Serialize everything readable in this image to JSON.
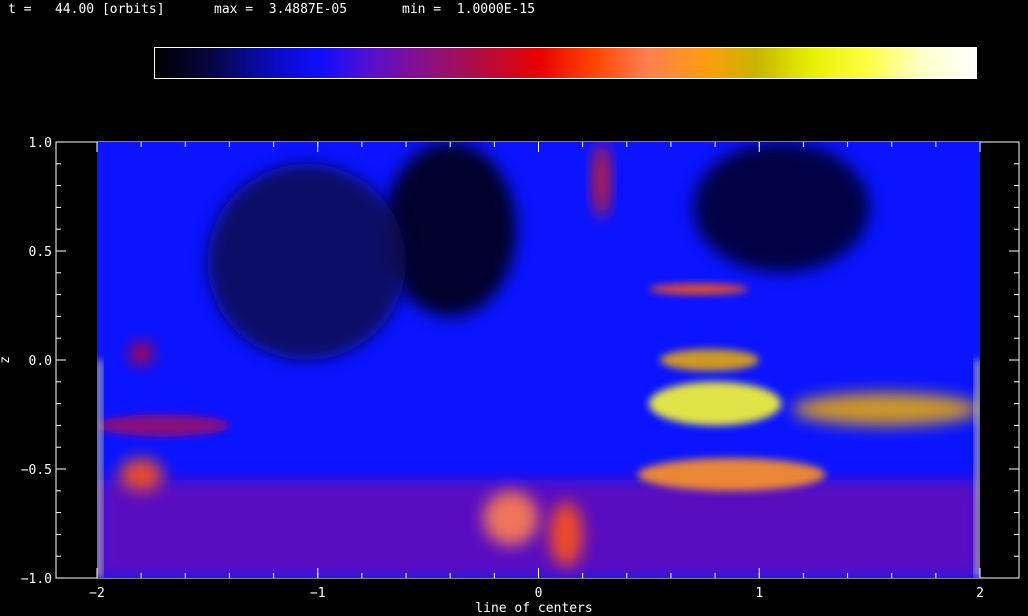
{
  "header": {
    "time_label": "t =",
    "time_value": "44.00",
    "time_unit": "[orbits]",
    "max_label": "max =",
    "max_value": "3.4887E-05",
    "min_label": "min =",
    "min_value": "1.0000E-15"
  },
  "colorbar": {
    "stops": [
      "#000000",
      "#060640",
      "#0a0ab0",
      "#0e0eff",
      "#5a10c8",
      "#8c1080",
      "#b40c3c",
      "#e80000",
      "#ff4400",
      "#ff8050",
      "#ff9a10",
      "#c8b400",
      "#e6f000",
      "#ffff40",
      "#ffffc8",
      "#ffffff"
    ]
  },
  "chart_data": {
    "type": "heatmap",
    "xlabel": "line of centers",
    "ylabel": "z",
    "xlim": [
      -2,
      2
    ],
    "ylim": [
      -1.0,
      1.0
    ],
    "xticks": [
      -2,
      -1,
      0,
      1,
      2
    ],
    "xtick_labels": [
      "−2",
      "−1",
      "0",
      "1",
      "2"
    ],
    "yticks": [
      -1.0,
      -0.5,
      0.0,
      0.5,
      1.0
    ],
    "ytick_labels": [
      "−1.0",
      "−0.5",
      "0.0",
      "0.5",
      "1.0"
    ],
    "value_range": [
      1e-15,
      3.4887e-05
    ],
    "background_color": "#0a14ff",
    "features": [
      {
        "kind": "band",
        "x": [
          -2.0,
          2.0
        ],
        "y": [
          -1.0,
          -0.55
        ],
        "level": 0.28
      },
      {
        "kind": "blob",
        "x": [
          -0.7,
          -0.1
        ],
        "y": [
          0.2,
          1.0
        ],
        "level": 0.02
      },
      {
        "kind": "blob",
        "x": [
          -1.5,
          -0.6
        ],
        "y": [
          0.0,
          0.9
        ],
        "level": 0.08
      },
      {
        "kind": "blob",
        "x": [
          0.7,
          1.5
        ],
        "y": [
          0.4,
          1.0
        ],
        "level": 0.05
      },
      {
        "kind": "streak",
        "x": [
          -2.0,
          -1.4
        ],
        "y": [
          -0.35,
          -0.25
        ],
        "level": 0.35
      },
      {
        "kind": "blob",
        "x": [
          -1.85,
          -1.75
        ],
        "y": [
          -0.02,
          0.08
        ],
        "level": 0.45
      },
      {
        "kind": "blob",
        "x": [
          -1.9,
          -1.7
        ],
        "y": [
          -0.6,
          -0.45
        ],
        "level": 0.55
      },
      {
        "kind": "blob",
        "x": [
          0.25,
          0.32
        ],
        "y": [
          0.65,
          1.0
        ],
        "level": 0.5
      },
      {
        "kind": "blob",
        "x": [
          1.15,
          2.0
        ],
        "y": [
          -0.3,
          -0.15
        ],
        "level": 0.7
      },
      {
        "kind": "streak",
        "x": [
          0.45,
          1.3
        ],
        "y": [
          -0.6,
          -0.45
        ],
        "level": 0.65
      },
      {
        "kind": "streak",
        "x": [
          0.5,
          1.1
        ],
        "y": [
          -0.3,
          -0.1
        ],
        "level": 0.85
      },
      {
        "kind": "streak",
        "x": [
          0.55,
          1.0
        ],
        "y": [
          -0.05,
          0.05
        ],
        "level": 0.7
      },
      {
        "kind": "streak",
        "x": [
          0.5,
          0.95
        ],
        "y": [
          0.3,
          0.35
        ],
        "level": 0.55
      },
      {
        "kind": "blob",
        "x": [
          -0.25,
          0.0
        ],
        "y": [
          -0.85,
          -0.6
        ],
        "level": 0.6
      },
      {
        "kind": "blob",
        "x": [
          0.05,
          0.2
        ],
        "y": [
          -0.95,
          -0.65
        ],
        "level": 0.55
      },
      {
        "kind": "edge",
        "x": [
          -2.0,
          -1.98
        ],
        "y": [
          -1.0,
          0.0
        ],
        "level": 0.9
      },
      {
        "kind": "edge",
        "x": [
          1.98,
          2.0
        ],
        "y": [
          -1.0,
          0.0
        ],
        "level": 0.9
      }
    ]
  }
}
